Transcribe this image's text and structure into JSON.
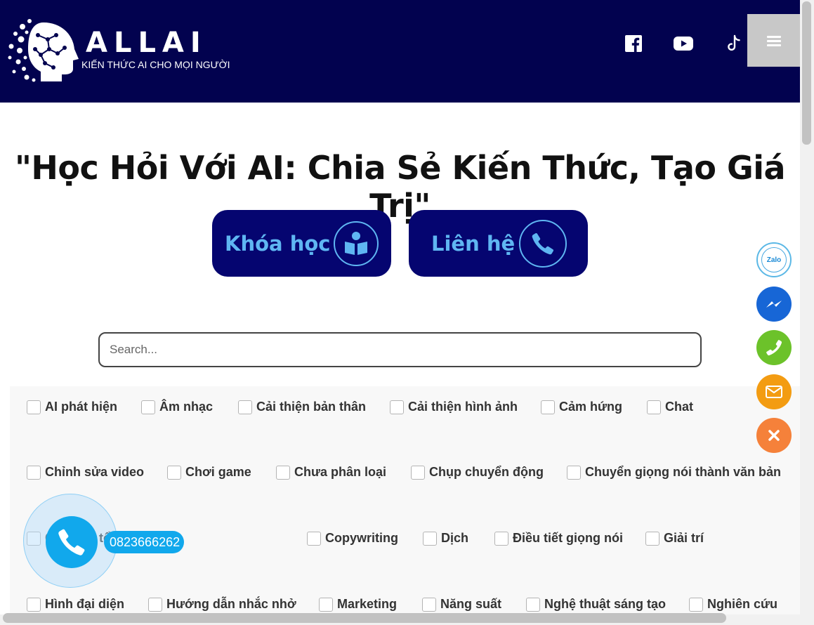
{
  "header": {
    "logo_name": "ALLAI",
    "logo_tagline": "KIẾN THỨC AI CHO  MỌI NGƯỜI",
    "social_icons": [
      "facebook-icon",
      "youtube-icon",
      "tiktok-icon"
    ],
    "menu_icon": "hamburger-icon",
    "background": "#02024f"
  },
  "hero": {
    "title": "\"Học Hỏi Với AI: Chia Sẻ Kiến Thức, Tạo Giá Trị\"",
    "buttons": [
      {
        "label": "Khóa học",
        "icon": "book-reader-icon"
      },
      {
        "label": "Liên hệ",
        "icon": "phone-icon"
      }
    ],
    "button_color": "#050570",
    "button_text_color": "#5fb6f2"
  },
  "search": {
    "placeholder": "Search..."
  },
  "categories": [
    "AI phát hiện",
    "Âm nhạc",
    "Cải thiện bản thân",
    "Cải thiện hình ảnh",
    "Cảm hứng",
    "Chat",
    "Chỉnh sửa video",
    "Chơi game",
    "Chưa phân loại",
    "Chụp chuyển động",
    "Chuyển giọng nói thành văn bản",
    "Công cụ tổng hợp",
    "Copywriting",
    "Dịch",
    "Điều tiết giọng nói",
    "Giải trí",
    "Hình đại diện",
    "Hướng dẫn nhắc nhở",
    "Marketing",
    "Năng suất",
    "Nghệ thuật sáng tạo",
    "Nghiên cứu"
  ],
  "floating_contacts": [
    {
      "icon": "zalo-icon",
      "label": "Zalo",
      "color": "#ffffff"
    },
    {
      "icon": "messenger-icon",
      "color": "#1766d6"
    },
    {
      "icon": "phone-icon",
      "color": "#6cc22a"
    },
    {
      "icon": "mail-icon",
      "color": "#f39c12"
    },
    {
      "icon": "close-icon",
      "color": "#f5813a"
    }
  ],
  "call_widget": {
    "phone_number": "0823666262",
    "color": "#11a8ec"
  }
}
